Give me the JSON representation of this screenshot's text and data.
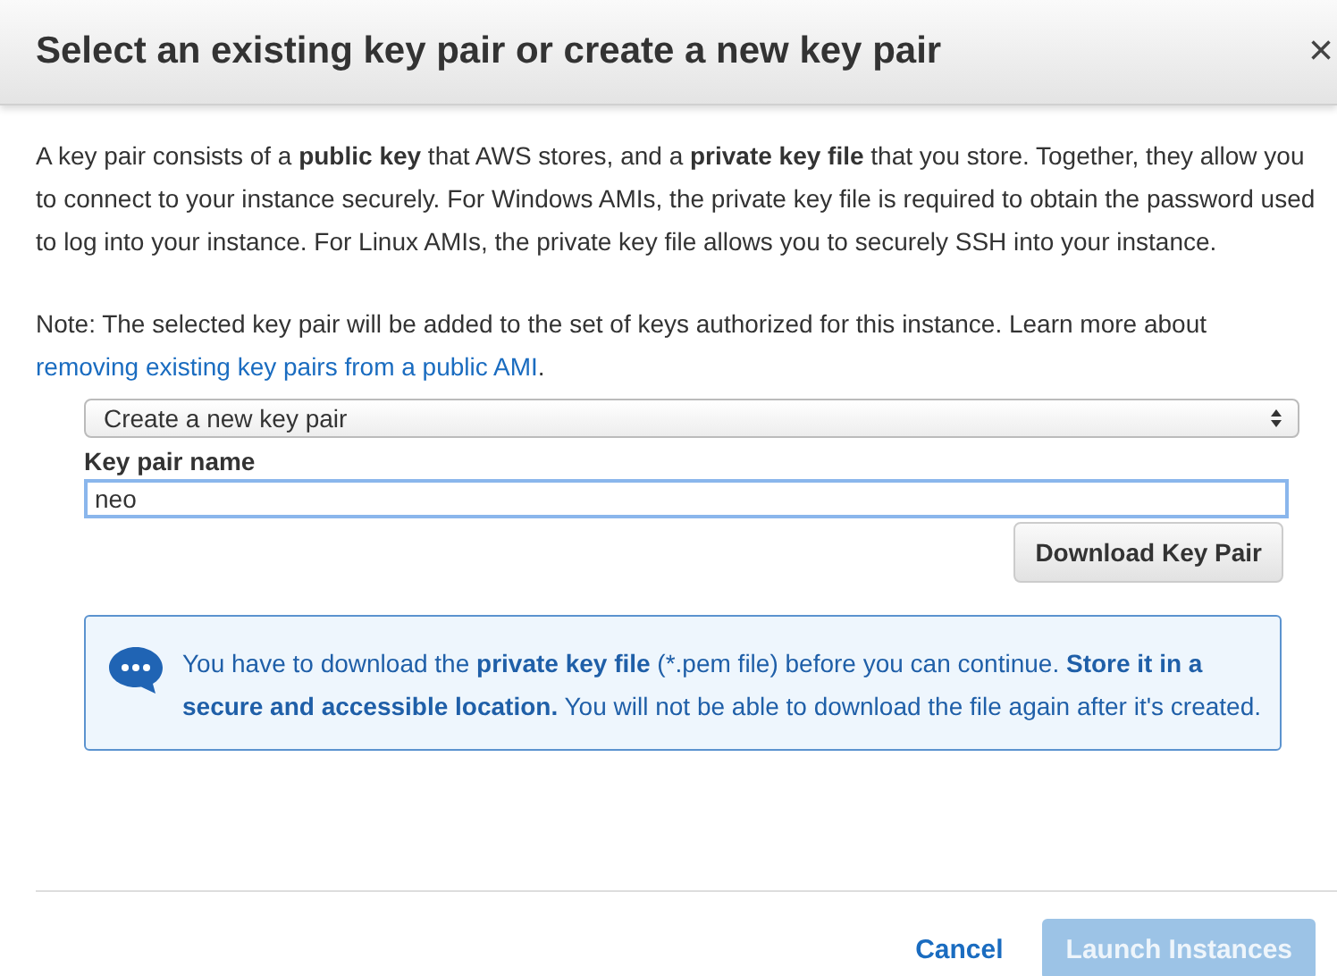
{
  "dialog": {
    "title": "Select an existing key pair or create a new key pair",
    "close": "×"
  },
  "intro": "A key pair consists of a **public key** that AWS stores, and a **private key file** that you store. Together, they allow you to connect to your instance securely. For Windows AMIs, the private key file is required to obtain the password used to log into your instance. For Linux AMIs, the private key file allows you to securely SSH into your instance.",
  "note": {
    "text": "Note: The selected key pair will be added to the set of keys authorized for this instance. Learn more about",
    "link": "removing existing key pairs from a public AMI",
    "after": "."
  },
  "key_pair_select": {
    "value": "Create a new key pair"
  },
  "key_pair_name": {
    "label": "Key pair name",
    "value": "neo",
    "focused": true
  },
  "download_button": {
    "label": "Download Key Pair"
  },
  "info": {
    "text": "You have to download the **private key file** (*.pem file) before you can continue. **Store it in a secure and accessible location.** You will not be able to download the file again after it's created."
  },
  "buttons": [
    {
      "label": "Cancel",
      "kind": "link",
      "disabled": false
    },
    {
      "label": "Launch Instances",
      "kind": "primary",
      "disabled": true
    }
  ]
}
